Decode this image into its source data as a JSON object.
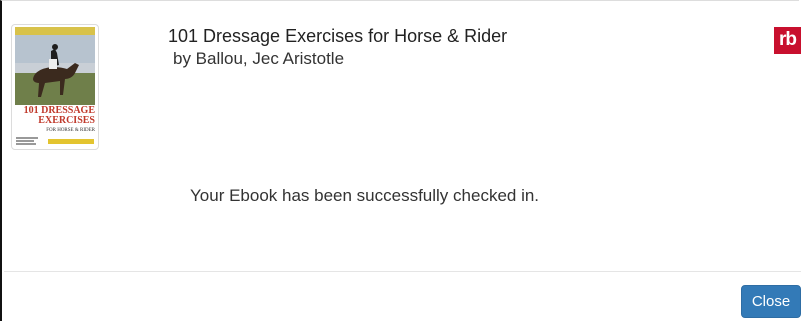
{
  "book": {
    "title": "101 Dressage Exercises for Horse & Rider",
    "author": "by Ballou, Jec Aristotle",
    "cover": {
      "title_line1": "101 DRESSAGE",
      "title_line2": "EXERCISES",
      "subtitle": "FOR HORSE & RIDER"
    }
  },
  "logo": {
    "text": "rb",
    "color": "#c8102e"
  },
  "message": "Your Ebook has been successfully checked in.",
  "footer": {
    "close_label": "Close",
    "accent": "#337ab7"
  }
}
